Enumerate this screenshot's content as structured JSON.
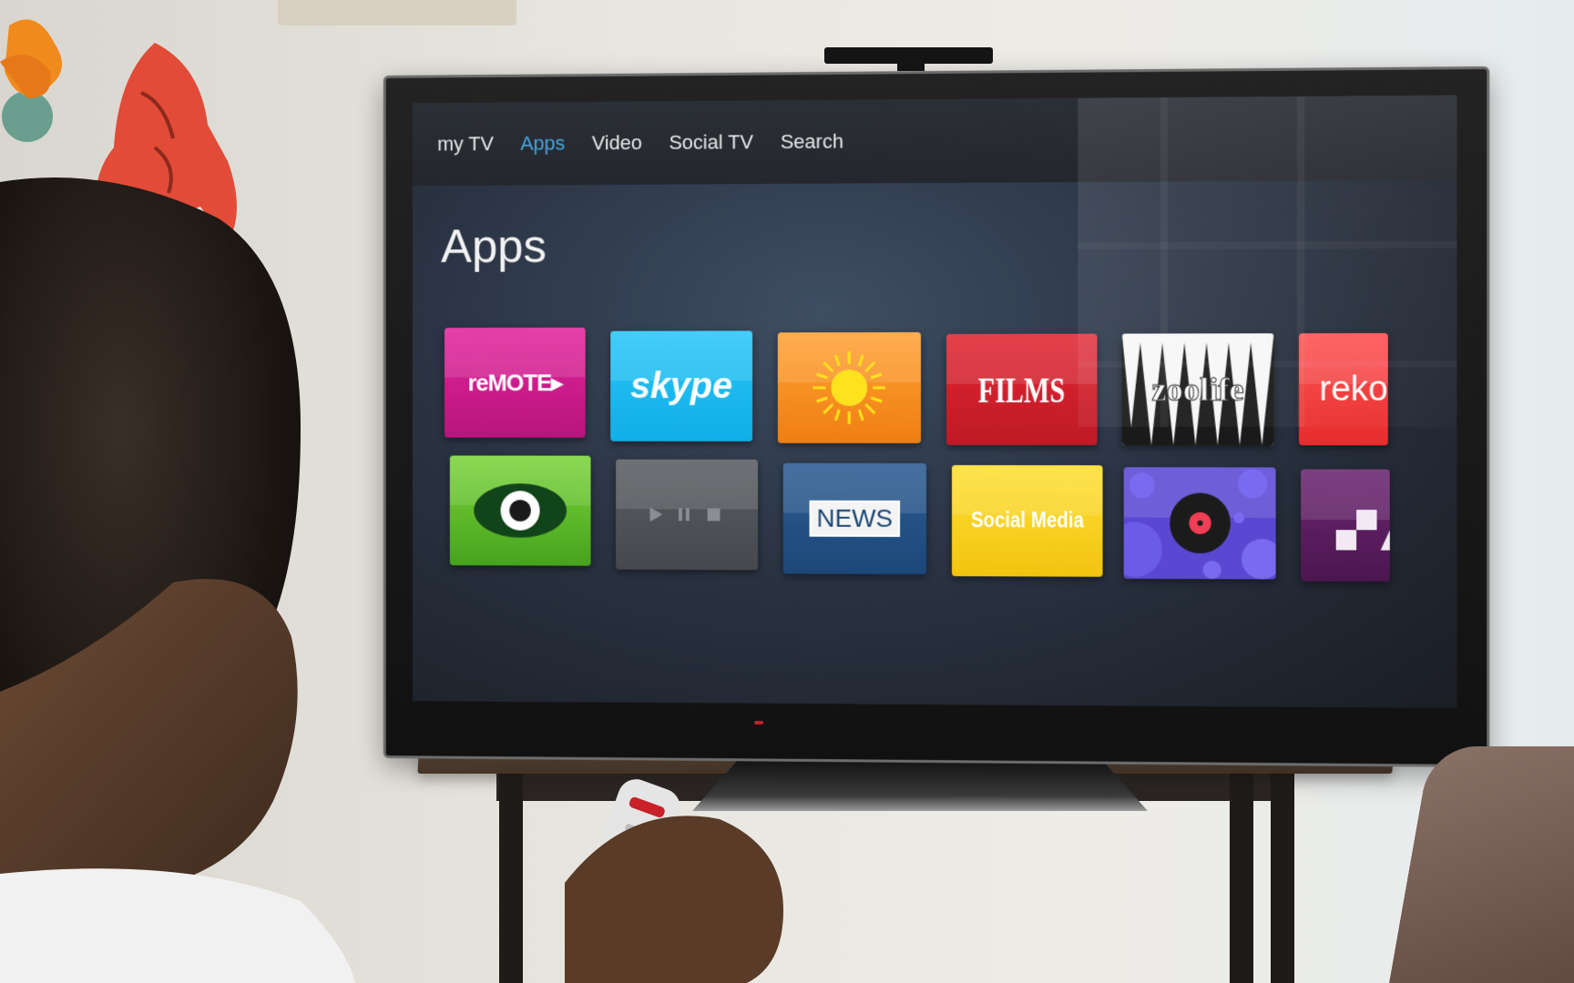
{
  "nav": {
    "items": [
      {
        "label": "my TV"
      },
      {
        "label": "Apps"
      },
      {
        "label": "Video"
      },
      {
        "label": "Social TV"
      },
      {
        "label": "Search"
      }
    ],
    "active": "Apps"
  },
  "page": {
    "title": "Apps"
  },
  "apps": {
    "row1": [
      {
        "label": "reMOTE▸",
        "color": "#d01f8f"
      },
      {
        "label": "skype",
        "color": "#1bb9f0"
      },
      {
        "label": "",
        "icon": "sun-icon",
        "color": "#f7901f"
      },
      {
        "label": "FILMS",
        "color": "#d2212d"
      },
      {
        "label": "zoolife",
        "color": "#f6f6f6"
      },
      {
        "label": "reko",
        "color": "#f23a3a"
      }
    ],
    "row2": [
      {
        "label": "",
        "icon": "eye-icon",
        "color": "#5dbb2b"
      },
      {
        "label": "",
        "icon": "media-controls-icon",
        "color": "#505357"
      },
      {
        "label": "NEWS",
        "color": "#245287"
      },
      {
        "label": "Social Media",
        "color": "#f8d21e"
      },
      {
        "label": "",
        "icon": "vinyl-record-icon",
        "color": "#5a48d2"
      },
      {
        "label": "",
        "icon": "pixel-blocks-icon",
        "color": "#5b1d60"
      }
    ]
  }
}
